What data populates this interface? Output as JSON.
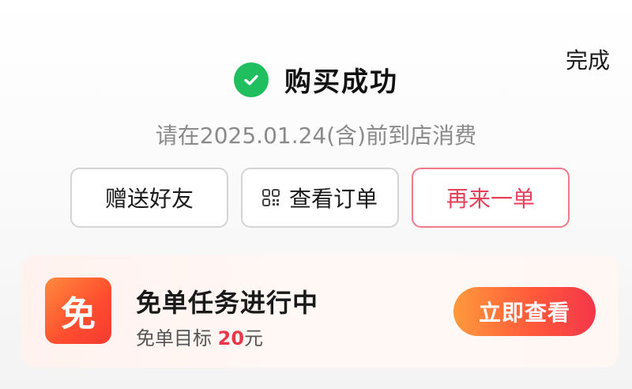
{
  "header": {
    "done_label": "完成"
  },
  "result": {
    "icon": "check-circle-icon",
    "title": "购买成功",
    "notice": "请在2025.01.24(含)前到店消费",
    "success_color": "#1fbf5f"
  },
  "actions": {
    "gift_label": "赠送好友",
    "view_order_label": "查看订单",
    "view_order_icon": "qr-code-icon",
    "reorder_label": "再来一单",
    "accent_color": "#e8405a"
  },
  "free_task": {
    "badge_text": "免",
    "title": "免单任务进行中",
    "target_prefix": "免单目标",
    "target_amount": "20",
    "target_unit": "元",
    "view_label": "立即查看"
  }
}
